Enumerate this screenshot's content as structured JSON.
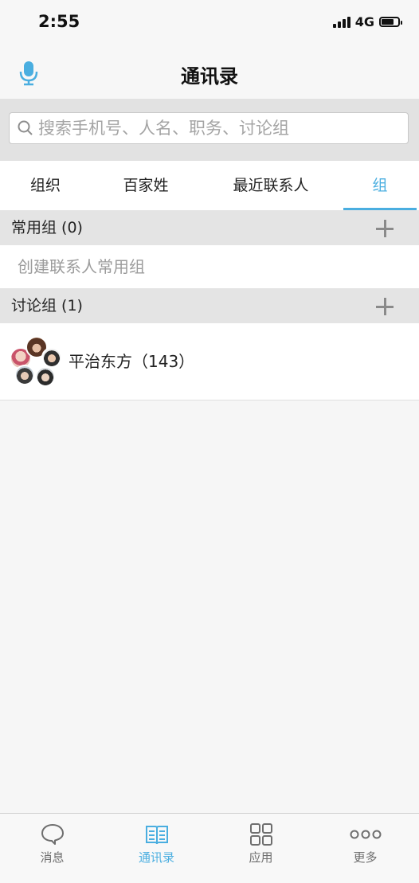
{
  "status_bar": {
    "time": "2:55",
    "network": "4G"
  },
  "nav": {
    "title": "通讯录",
    "mic_icon": "microphone-icon"
  },
  "search": {
    "placeholder": "搜索手机号、人名、职务、讨论组"
  },
  "tabs": [
    {
      "label": "组织",
      "active": false
    },
    {
      "label": "百家姓",
      "active": false
    },
    {
      "label": "最近联系人",
      "active": false
    },
    {
      "label": "组",
      "active": true
    }
  ],
  "sections": {
    "common_groups": {
      "label": "常用组 (0)",
      "empty_text": "创建联系人常用组"
    },
    "discussion_groups": {
      "label": "讨论组 (1)"
    }
  },
  "discussion_group_items": [
    {
      "name": "平治东方（143）"
    }
  ],
  "tab_bar": [
    {
      "label": "消息",
      "icon": "chat-bubble-icon",
      "active": false
    },
    {
      "label": "通讯录",
      "icon": "contacts-book-icon",
      "active": true
    },
    {
      "label": "应用",
      "icon": "apps-grid-icon",
      "active": false
    },
    {
      "label": "更多",
      "icon": "more-dots-icon",
      "active": false
    }
  ],
  "colors": {
    "accent": "#4aaee0",
    "section_bg": "#e4e4e4",
    "page_bg": "#f6f6f6"
  }
}
